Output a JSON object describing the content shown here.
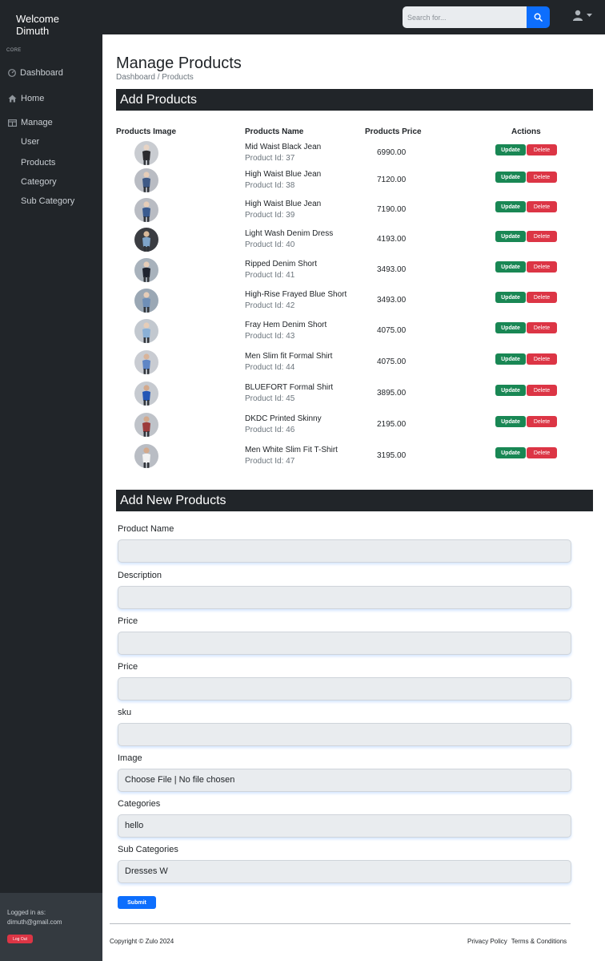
{
  "topbar": {
    "brand": "Welcome Dimuth",
    "search_placeholder": "Search for...",
    "search_icon": "search-icon",
    "user_icon": "user-icon"
  },
  "sidebar": {
    "heading": "CORE",
    "dashboard": "Dashboard",
    "home": "Home",
    "manage": "Manage",
    "sub_items": [
      "User",
      "Products",
      "Category",
      "Sub Category"
    ],
    "footer_label": "Logged in as:",
    "footer_email": "dimuth@gmail.com",
    "logout_label": "Log Out"
  },
  "page": {
    "title": "Manage Products",
    "breadcrumb": "Dashboard / Products",
    "add_products_heading": "Add Products",
    "add_new_heading": "Add New Products"
  },
  "table": {
    "headers": [
      "Products Image",
      "Products Name",
      "Products Price",
      "Actions"
    ],
    "update_label": "Update",
    "delete_label": "Delete",
    "rows": [
      {
        "name": "Mid Waist Black Jean",
        "id": "Product Id: 37",
        "price": "6990.00"
      },
      {
        "name": "High Waist Blue Jean",
        "id": "Product Id: 38",
        "price": "7120.00"
      },
      {
        "name": "High Waist Blue Jean",
        "id": "Product Id: 39",
        "price": "7190.00"
      },
      {
        "name": "Light Wash Denim Dress",
        "id": "Product Id: 40",
        "price": "4193.00"
      },
      {
        "name": "Ripped Denim Short",
        "id": "Product Id: 41",
        "price": "3493.00"
      },
      {
        "name": "High-Rise Frayed Blue Short",
        "id": "Product Id: 42",
        "price": "3493.00"
      },
      {
        "name": "Fray Hem Denim Short",
        "id": "Product Id: 43",
        "price": "4075.00"
      },
      {
        "name": "Men Slim fit Formal Shirt",
        "id": "Product Id: 44",
        "price": "4075.00"
      },
      {
        "name": "BLUEFORT Formal Shirt",
        "id": "Product Id: 45",
        "price": "3895.00"
      },
      {
        "name": "DKDC Printed Skinny",
        "id": "Product Id: 46",
        "price": "2195.00"
      },
      {
        "name": "Men White Slim Fit T-Shirt",
        "id": "Product Id: 47",
        "price": "3195.00"
      }
    ]
  },
  "form": {
    "product_name_label": "Product Name",
    "description_label": "Description",
    "price_label": "Price",
    "price2_label": "Price",
    "sku_label": "sku",
    "image_label": "Image",
    "image_value": "Choose File | No file chosen",
    "categories_label": "Categories",
    "categories_value": "hello",
    "subcategories_label": "Sub Categories",
    "subcategories_value": "Dresses W",
    "submit_label": "Submit"
  },
  "footer": {
    "copyright": "Copyright © Zulo 2024",
    "privacy": "Privacy Policy",
    "terms": "Terms & Conditions"
  },
  "colors": {
    "dark": "#212529",
    "primary": "#0d6efd",
    "success": "#198754",
    "danger": "#dc3545"
  }
}
